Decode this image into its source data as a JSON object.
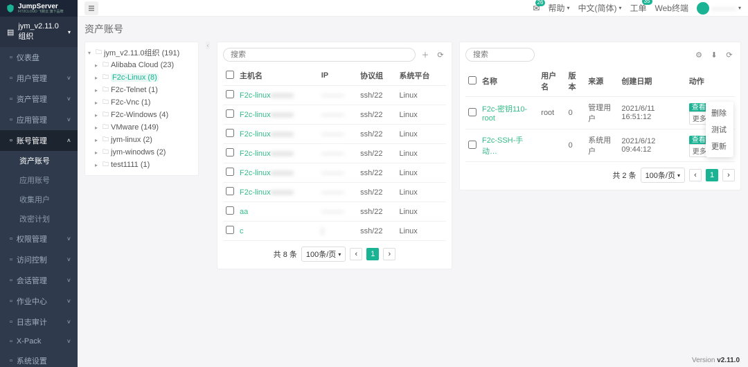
{
  "brand": {
    "name": "JumpServer",
    "sub": "FIT2CLOUD 飞致云 旗下品牌"
  },
  "header": {
    "badge1": "26",
    "badge2": "35",
    "help": "帮助",
    "lang": "中文(简体)",
    "ticket": "工单",
    "webterm": "Web终端",
    "user": "———"
  },
  "sidebar": {
    "org": "jym_v2.11.0组织",
    "items": [
      "仪表盘",
      "用户管理",
      "资产管理",
      "应用管理",
      "账号管理",
      "权限管理",
      "访问控制",
      "会话管理",
      "作业中心",
      "日志审计",
      "X-Pack",
      "系统设置"
    ],
    "expanded": [
      "资产账号",
      "应用账号",
      "收集用户",
      "改密计划"
    ]
  },
  "page_title": "资产账号",
  "search_placeholder": "搜索",
  "tree": [
    {
      "d": 1,
      "open": true,
      "label": "jym_v2.11.0组织 (191)"
    },
    {
      "d": 2,
      "label": "Alibaba Cloud (23)"
    },
    {
      "d": 2,
      "label": "F2c-Linux (8)",
      "selected": true
    },
    {
      "d": 2,
      "label": "F2c-Telnet (1)"
    },
    {
      "d": 2,
      "label": "F2c-Vnc (1)"
    },
    {
      "d": 2,
      "label": "F2c-Windows (4)"
    },
    {
      "d": 2,
      "label": "VMware (149)"
    },
    {
      "d": 2,
      "label": "jym-linux (2)"
    },
    {
      "d": 2,
      "label": "jym-winodws (2)"
    },
    {
      "d": 2,
      "label": "test1111 (1)"
    }
  ],
  "left_table": {
    "cols": [
      "主机名",
      "IP",
      "协议组",
      "系统平台"
    ],
    "rows": [
      {
        "host": "F2c-linux———",
        "ip": "———",
        "proto": "ssh/22",
        "plat": "Linux"
      },
      {
        "host": "F2c-linux———",
        "ip": "———",
        "proto": "ssh/22",
        "plat": "Linux"
      },
      {
        "host": "F2c-linux———",
        "ip": "———",
        "proto": "ssh/22",
        "plat": "Linux"
      },
      {
        "host": "F2c-linux———",
        "ip": "———",
        "proto": "ssh/22",
        "plat": "Linux"
      },
      {
        "host": "F2c-linux———",
        "ip": "———",
        "proto": "ssh/22",
        "plat": "Linux"
      },
      {
        "host": "F2c-linux———",
        "ip": "———",
        "proto": "ssh/22",
        "plat": "Linux"
      },
      {
        "host": "aa",
        "ip": "———",
        "proto": "ssh/22",
        "plat": "Linux"
      },
      {
        "host": "c",
        "ip": "(",
        "proto": "ssh/22",
        "plat": "Linux"
      }
    ],
    "total": "共 8 条",
    "per": "100条/页"
  },
  "right_table": {
    "cols": [
      "名称",
      "用户名",
      "版本",
      "来源",
      "创建日期",
      "动作"
    ],
    "rows": [
      {
        "name": "F2c-密钥110-root",
        "user": "root",
        "ver": "0",
        "src": "管理用户",
        "date": "2021/6/11 16:51:12"
      },
      {
        "name": "F2c-SSH-手动…",
        "user": "",
        "ver": "0",
        "src": "系统用户",
        "date": "2021/6/12 09:44:12"
      }
    ],
    "view": "查看",
    "more": "更多",
    "total": "共 2 条",
    "per": "100条/页"
  },
  "dropdown": [
    "删除",
    "测试",
    "更新"
  ],
  "version": {
    "label": "Version ",
    "val": "v2.11.0"
  }
}
